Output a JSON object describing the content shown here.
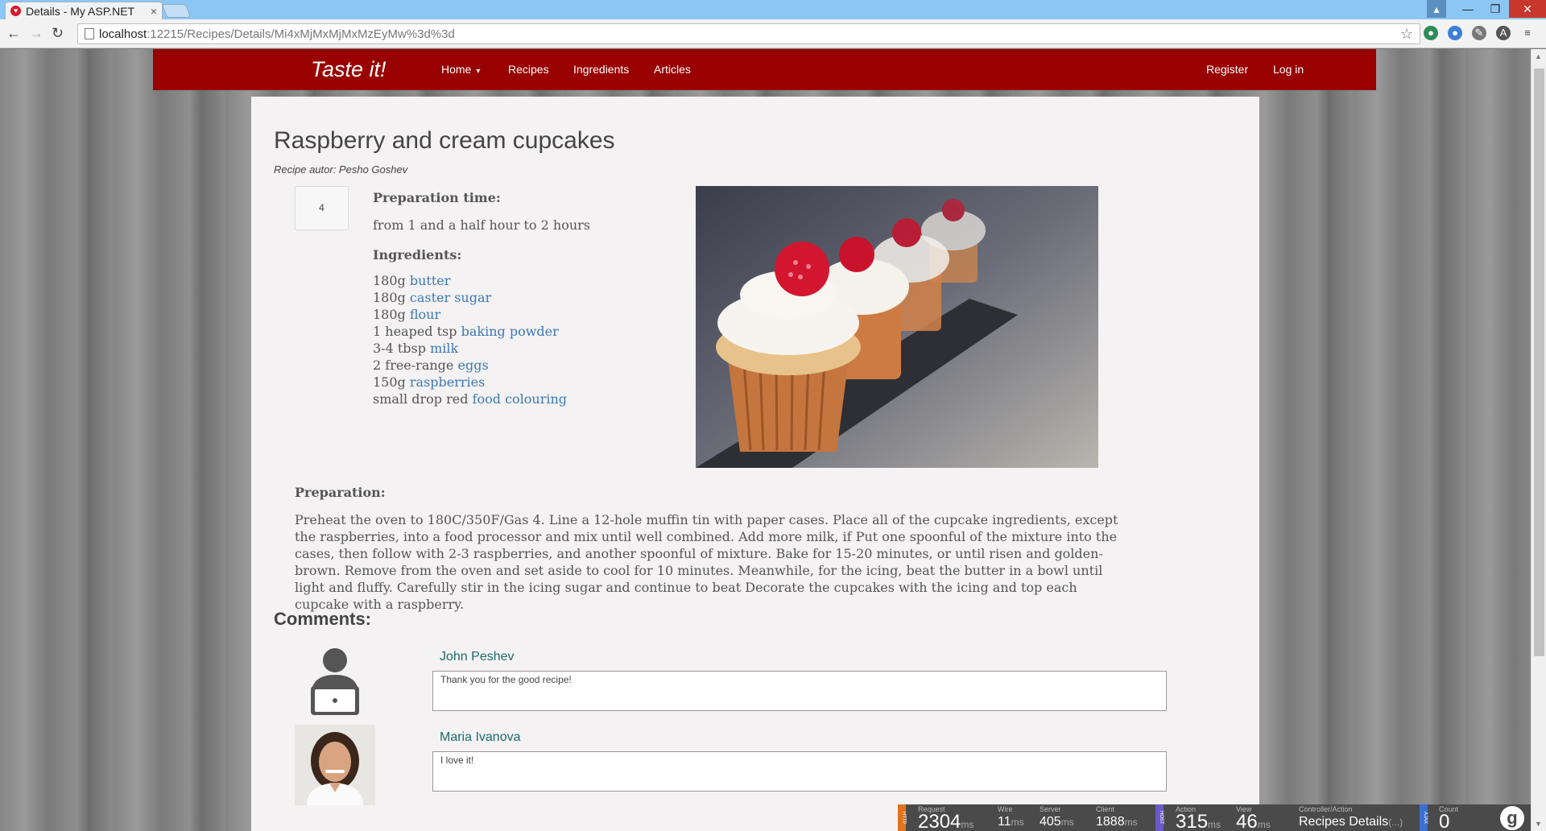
{
  "browser": {
    "tab_title": "Details - My ASP.NET",
    "tab_close": "×",
    "url_host": "localhost",
    "url_path": ":12215/Recipes/Details/Mi4xMjMxMjMxMzEyMw%3d%3d"
  },
  "navbar": {
    "brand": "Taste it!",
    "items": [
      {
        "label": "Home"
      },
      {
        "label": "Recipes"
      },
      {
        "label": "Ingredients"
      },
      {
        "label": "Articles"
      }
    ],
    "register": "Register",
    "login": "Log in"
  },
  "recipe": {
    "title": "Raspberry and cream cupcakes",
    "author": "Recipe autor: Pesho Goshev",
    "rating": "4",
    "prep_time_label": "Preparation time:",
    "prep_time": "from 1 and a half hour to 2 hours",
    "ingredients_label": "Ingredients:",
    "ingredients": [
      {
        "qty": "180g",
        "name": "butter"
      },
      {
        "qty": "180g",
        "name": "caster sugar"
      },
      {
        "qty": "180g",
        "name": "flour"
      },
      {
        "qty": "1 heaped tsp",
        "name": "baking powder"
      },
      {
        "qty": "3-4 tbsp",
        "name": "milk"
      },
      {
        "qty": "2 free-range",
        "name": "eggs"
      },
      {
        "qty": "150g",
        "name": "raspberries"
      },
      {
        "qty": "small drop red",
        "name": "food colouring"
      }
    ],
    "preparation_label": "Preparation:",
    "preparation": "Preheat the oven to 180C/350F/Gas 4. Line a 12-hole muffin tin with paper cases. Place all of the cupcake ingredients, except the raspberries, into a food processor and mix until well combined. Add more milk, if Put one spoonful of the mixture into the cases, then follow with 2-3 raspberries, and another spoonful of mixture. Bake for 15-20 minutes, or until risen and golden-brown. Remove from the oven and set aside to cool for 10 minutes. Meanwhile, for the icing, beat the butter in a bowl until light and fluffy. Carefully stir in the icing sugar and continue to beat Decorate the cupcakes with the icing and top each cupcake with a raspberry."
  },
  "comments": {
    "title": "Comments:",
    "items": [
      {
        "author": "John Peshev",
        "text": "Thank you for the good recipe!"
      },
      {
        "author": "Maria Ivanova",
        "text": "I love it!"
      }
    ]
  },
  "glimpse": {
    "http_tag": "HTTP",
    "host_tag": "HOST",
    "ajax_tag": "AJAX",
    "request_label": "Request",
    "request": "2304",
    "ms": "ms",
    "wire_label": "Wire",
    "wire": "11",
    "server_label": "Server",
    "server": "405",
    "client_label": "Client",
    "client": "1888",
    "action_label": "Action",
    "action": "315",
    "view_label": "View",
    "view": "46",
    "controller_label": "Controller/Action",
    "controller": "Recipes Details",
    "controller_suffix": "(...)",
    "count_label": "Count",
    "count": "0"
  },
  "colors": {
    "navbar": "#990000",
    "link": "#3a78b5",
    "comment_author": "#1d6a6d"
  }
}
